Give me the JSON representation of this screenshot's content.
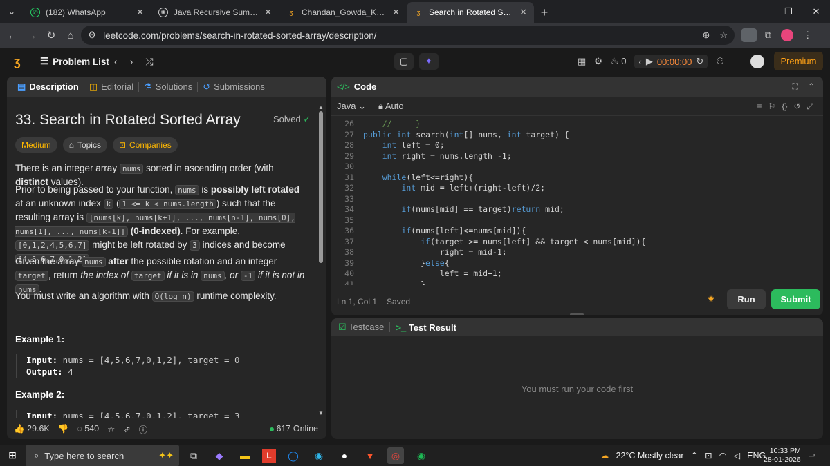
{
  "browser": {
    "tabs": [
      {
        "label": "(182) WhatsApp",
        "icon": "whatsapp-icon",
        "color": "#25d366"
      },
      {
        "label": "Java Recursive Sum Fix",
        "icon": "openai-icon",
        "color": "#cccccc"
      },
      {
        "label": "Chandan_Gowda_K_S - LeetCod",
        "icon": "leetcode-icon",
        "color": "#f5a623"
      },
      {
        "label": "Search in Rotated Sorted Array",
        "icon": "leetcode-icon",
        "color": "#f5a623"
      }
    ],
    "url": "leetcode.com/problems/search-in-rotated-sorted-array/description/"
  },
  "lc_nav": {
    "problem_list": "Problem List",
    "streak": "0",
    "timer": "00:00:00",
    "premium": "Premium"
  },
  "left_tabs": [
    "Description",
    "Editorial",
    "Solutions",
    "Submissions"
  ],
  "problem": {
    "title": "33. Search in Rotated Sorted Array",
    "solved": "Solved",
    "difficulty": "Medium",
    "topics": "Topics",
    "companies": "Companies",
    "p1_a": "There is an integer array ",
    "p1_code": "nums",
    "p1_b": " sorted in ascending order (with ",
    "p1_bold": "distinct",
    "p1_c": " values).",
    "p2_a": "Prior to being passed to your function, ",
    "p2_code1": "nums",
    "p2_b": " is ",
    "p2_bold": "possibly left rotated",
    "p2_c": " at an unknown index ",
    "p2_code2": "k",
    "p2_d": " (",
    "p2_code3": "1 <= k < nums.length",
    "p2_e": ") such that the resulting array is ",
    "p2_code4": "[nums[k], nums[k+1], ..., nums[n-1], nums[0], nums[1], ..., nums[k-1]]",
    "p2_f": " ",
    "p2_bold2": "(0-indexed)",
    "p2_g": ". For example, ",
    "p2_code5": "[0,1,2,4,5,6,7]",
    "p2_h": " might be left rotated by ",
    "p2_code6": "3",
    "p2_i": " indices and become ",
    "p2_code7": "[4,5,6,7,0,1,2]",
    "p2_j": ".",
    "p3_a": "Given the array ",
    "p3_code1": "nums",
    "p3_bold": " after",
    "p3_b": " the possible rotation and an integer ",
    "p3_code2": "target",
    "p3_c": ", return ",
    "p3_it1": "the index of ",
    "p3_code3": "target",
    "p3_it2": " if it is in ",
    "p3_code4": "nums",
    "p3_it3": ", or ",
    "p3_code5": "-1",
    "p3_it4": " if it is not in ",
    "p3_code6": "nums",
    "p3_d": ".",
    "p4_a": "You must write an algorithm with ",
    "p4_code": "O(log n)",
    "p4_b": " runtime complexity.",
    "ex1_title": "Example 1:",
    "ex1_input_label": "Input:",
    "ex1_input": " nums = [4,5,6,7,0,1,2], target = 0",
    "ex1_output_label": "Output:",
    "ex1_output": " 4",
    "ex2_title": "Example 2:",
    "ex2_input_label": "Input:",
    "ex2_input": " nums = [4,5,6,7,0,1,2], target = 3"
  },
  "left_footer": {
    "likes": "29.6K",
    "comments": "540",
    "online": "617 Online"
  },
  "code_panel": {
    "title": "Code",
    "language": "Java",
    "mode": "Auto",
    "status_pos": "Ln 1, Col 1",
    "status_saved": "Saved",
    "run": "Run",
    "submit": "Submit",
    "lines": [
      {
        "n": "26",
        "t": "    //     }"
      },
      {
        "n": "27",
        "t": "public int search(int[] nums, int target) {"
      },
      {
        "n": "28",
        "t": "    int left = 0;"
      },
      {
        "n": "29",
        "t": "    int right = nums.length -1;"
      },
      {
        "n": "30",
        "t": ""
      },
      {
        "n": "31",
        "t": "    while(left<=right){"
      },
      {
        "n": "32",
        "t": "        int mid = left+(right-left)/2;"
      },
      {
        "n": "33",
        "t": ""
      },
      {
        "n": "34",
        "t": "        if(nums[mid] == target)return mid;"
      },
      {
        "n": "35",
        "t": ""
      },
      {
        "n": "36",
        "t": "        if(nums[left]<=nums[mid]){"
      },
      {
        "n": "37",
        "t": "            if(target >= nums[left] && target < nums[mid]){"
      },
      {
        "n": "38",
        "t": "                right = mid-1;"
      },
      {
        "n": "39",
        "t": "            }else{"
      },
      {
        "n": "40",
        "t": "                left = mid+1;"
      },
      {
        "n": "41",
        "t": "            }"
      }
    ]
  },
  "test_panel": {
    "testcase": "Testcase",
    "result": "Test Result",
    "message": "You must run your code first"
  },
  "taskbar": {
    "search_placeholder": "Type here to search",
    "weather": "22°C  Mostly clear",
    "lang": "ENG",
    "time": "10:33 PM",
    "date": "28-01-2026"
  },
  "colors": {
    "accent": "#ffa116",
    "green": "#2cbb5d",
    "medium": "#ffb800"
  }
}
